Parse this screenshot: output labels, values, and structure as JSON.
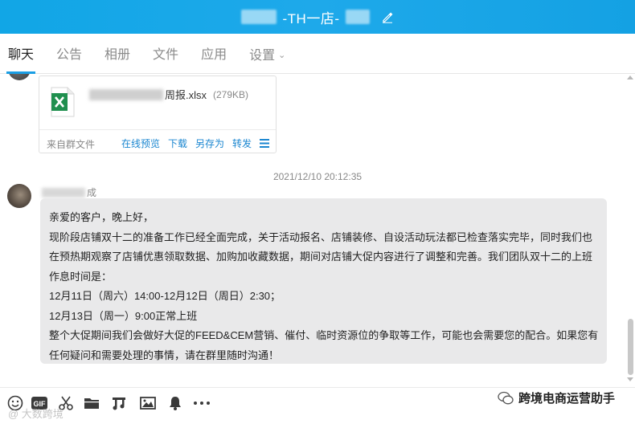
{
  "window": {
    "title": "-TH一店-",
    "edit_icon": "edit-pencil-icon",
    "titlebar_color": "#16a4e6"
  },
  "tabs": [
    {
      "label": "聊天",
      "active": true
    },
    {
      "label": "公告",
      "active": false
    },
    {
      "label": "相册",
      "active": false
    },
    {
      "label": "文件",
      "active": false
    },
    {
      "label": "应用",
      "active": false
    },
    {
      "label": "设置",
      "active": false
    }
  ],
  "file_message": {
    "file_name_suffix": "周报.xlsx",
    "file_size": "(279KB)",
    "source": "来自群文件",
    "actions": {
      "preview": "在线预览",
      "download": "下载",
      "save_as": "另存为",
      "forward": "转发"
    },
    "icon": "excel-file-icon"
  },
  "timestamp": "2021/12/10 20:12:35",
  "message": {
    "sender_suffix": "成",
    "lines": [
      "亲爱的客户，晚上好，",
      "现阶段店铺双十二的准备工作已经全面完成，关于活动报名、店铺装修、自设活动玩法都已检查落实完毕，同时我们也",
      "在预热期观察了店铺优惠领取数据、加购加收藏数据，期间对店铺大促内容进行了调整和完善。我们团队双十二的上班",
      "作息时间是：",
      "12月11日（周六）14:00-12月12日（周日）2:30；",
      "12月13日（周一）9:00正常上班",
      "整个大促期间我们会做好大促的FEED&CEM营销、催付、临时资源位的争取等工作，可能也会需要您的配合。如果您有",
      "任何疑问和需要处理的事情，请在群里随时沟通！"
    ]
  },
  "toolbar": {
    "icons": [
      "emoji-icon",
      "gif-icon",
      "scissors-icon",
      "folder-icon",
      "music-icon",
      "image-icon",
      "bell-icon",
      "more-icon"
    ],
    "gif_label": "GIF"
  },
  "watermark": {
    "left": "@ 大数跨境",
    "right": "跨境电商运营助手"
  }
}
